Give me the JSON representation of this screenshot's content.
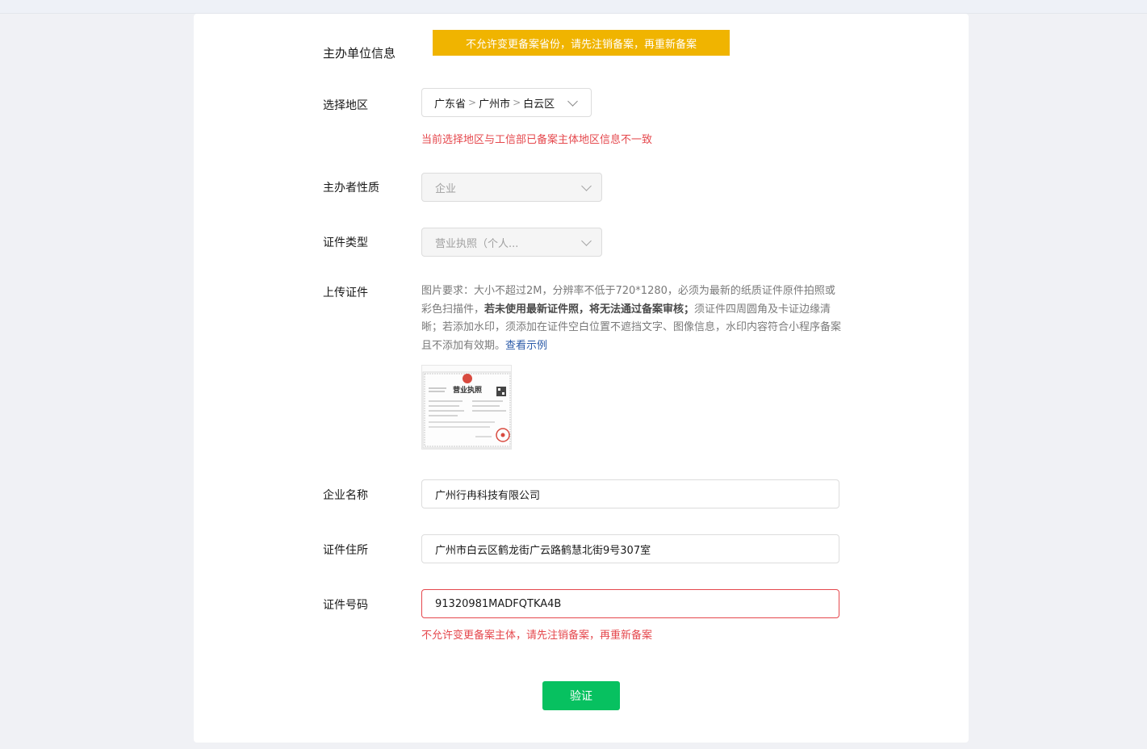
{
  "banner": {
    "text": "不允许变更备案省份，请先注销备案，再重新备案"
  },
  "section": {
    "title": "主办单位信息"
  },
  "region": {
    "label": "选择地区",
    "province": "广东省",
    "city": "广州市",
    "district": "白云区",
    "error": "当前选择地区与工信部已备案主体地区信息不一致"
  },
  "nature": {
    "label": "主办者性质",
    "value": "企业"
  },
  "cert_type": {
    "label": "证件类型",
    "value": "营业执照（个人..."
  },
  "upload": {
    "label": "上传证件",
    "desc_part1": "图片要求：大小不超过2M，分辨率不低于720*1280，必须为最新的纸质证件原件拍照或彩色扫描件，",
    "desc_bold": "若未使用最新证件照，将无法通过备案审核；",
    "desc_part2": "须证件四周圆角及卡证边缘清晰；若添加水印，须添加在证件空白位置不遮挡文字、图像信息，水印内容符合小程序备案且不添加有效期。",
    "example_link": "查看示例",
    "thumb_title": "营业执照"
  },
  "company_name": {
    "label": "企业名称",
    "value": "广州行冉科技有限公司"
  },
  "cert_address": {
    "label": "证件住所",
    "value": "广州市白云区鹤龙街广云路鹤慧北街9号307室"
  },
  "cert_number": {
    "label": "证件号码",
    "value": "91320981MADFQTKA4B",
    "error": "不允许变更备案主体，请先注销备案，再重新备案"
  },
  "submit": {
    "label": "验证"
  },
  "colors": {
    "banner": "#f0b400",
    "error": "#e5484d",
    "primary": "#07c160",
    "link": "#2b5aa8"
  }
}
